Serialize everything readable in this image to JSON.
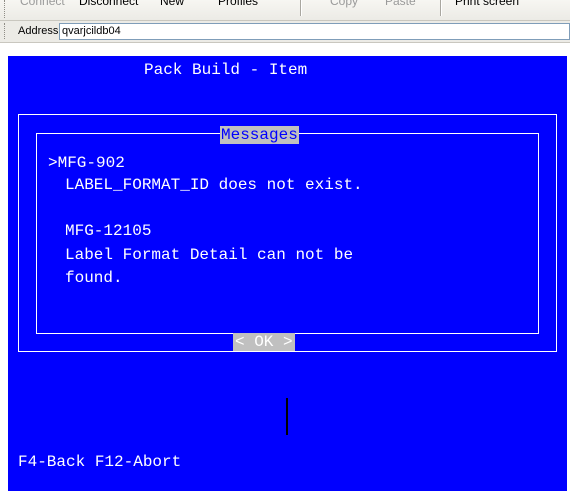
{
  "toolbar": {
    "connect_label": "Connect",
    "disconnect_label": "Disconnect",
    "new_label": "New",
    "profiles_label": "Profiles",
    "copy_label": "Copy",
    "paste_label": "Paste",
    "print_screen_label": "Print screen"
  },
  "address": {
    "label": "Address",
    "value": "qvarjcildb04"
  },
  "terminal": {
    "screen_title": "Pack Build - Item",
    "dialog": {
      "title": "Messages",
      "messages": [
        {
          "code": ">MFG-902",
          "text_lines": [
            "LABEL_FORMAT_ID does not exist."
          ]
        },
        {
          "code": "MFG-12105",
          "text_lines": [
            "Label Format Detail can not be",
            "found."
          ]
        }
      ],
      "ok_label": "< OK >"
    },
    "footer": "F4-Back F12-Abort"
  },
  "colors": {
    "terminal_background": "#0000ff",
    "terminal_text": "#ffffff",
    "highlight_background": "#c0c0c0"
  }
}
